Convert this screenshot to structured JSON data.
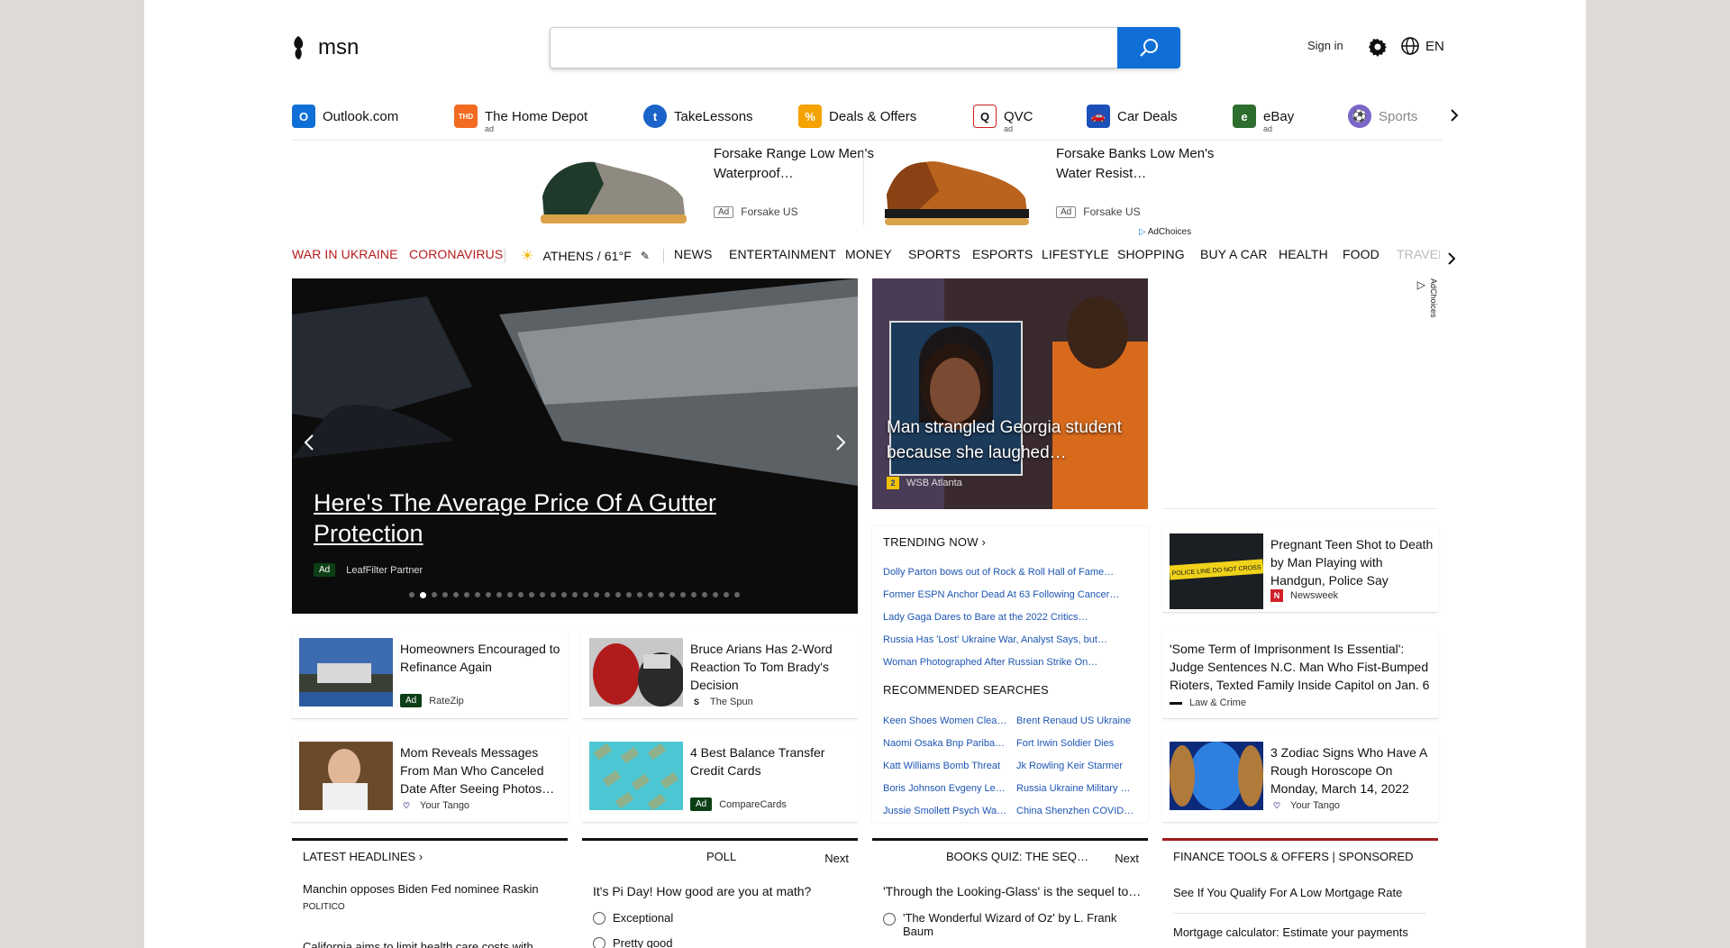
{
  "header": {
    "logo_text": "msn",
    "search_placeholder": "",
    "signin": "Sign in",
    "lang": "EN"
  },
  "quick_links": [
    {
      "label": "Outlook.com",
      "ad": "",
      "icon": "outlook-icon",
      "color": "#0f6fd6"
    },
    {
      "label": "The Home Depot",
      "ad": "ad",
      "icon": "home-depot-icon",
      "color": "#f26b21"
    },
    {
      "label": "TakeLessons",
      "ad": "",
      "icon": "takelessons-icon",
      "color": "#1b63c9"
    },
    {
      "label": "Deals & Offers",
      "ad": "",
      "icon": "deals-icon",
      "color": "#f5a300"
    },
    {
      "label": "QVC",
      "ad": "ad",
      "icon": "qvc-icon",
      "color": "#d02020"
    },
    {
      "label": "Car Deals",
      "ad": "",
      "icon": "car-icon",
      "color": "#1d4fb8"
    },
    {
      "label": "eBay",
      "ad": "ad",
      "icon": "ebay-icon",
      "color": "#2d6e2f"
    },
    {
      "label": "Sports",
      "ad": "",
      "icon": "sports-icon",
      "color": "#7a66c8"
    }
  ],
  "top_ads": [
    {
      "title": "Forsake Range Low Men's Waterproof…",
      "ad": "Ad",
      "source": "Forsake US"
    },
    {
      "title": "Forsake Banks Low Men's Water Resist…",
      "ad": "Ad",
      "source": "Forsake US"
    }
  ],
  "adchoices": "AdChoices",
  "nav": {
    "war": "WAR IN UKRAINE",
    "corona": "CORONAVIRUS",
    "weather": "ATHENS / 61°F",
    "items": [
      "NEWS",
      "ENTERTAINMENT",
      "MONEY",
      "SPORTS",
      "ESPORTS",
      "LIFESTYLE",
      "SHOPPING",
      "BUY A CAR",
      "HEALTH",
      "FOOD",
      "TRAVEL"
    ]
  },
  "hero": {
    "title": "Here's The Average Price Of A Gutter Protection",
    "ad": "Ad",
    "source": "LeafFilter Partner"
  },
  "mid_hero": {
    "title": "Man strangled Georgia student because she laughed…",
    "source": "WSB Atlanta"
  },
  "trending": {
    "title": "TRENDING NOW",
    "items": [
      "Dolly Parton bows out of Rock & Roll Hall of Fame…",
      "Former ESPN Anchor Dead At 63 Following Cancer…",
      "Lady Gaga Dares to Bare at the 2022 Critics…",
      "Russia Has 'Lost' Ukraine War, Analyst Says, but…",
      "Woman Photographed After Russian Strike On…"
    ],
    "rec_title": "RECOMMENDED SEARCHES",
    "rec_left": [
      "Keen Shoes Women Clea…",
      "Naomi Osaka Bnp Pariba…",
      "Katt Williams Bomb Threat",
      "Boris Johnson Evgeny Le…",
      "Jussie Smollett Psych Wa…"
    ],
    "rec_right": [
      "Brent Renaud US Ukraine",
      "Fort Irwin Soldier Dies",
      "Jk Rowling Keir Starmer",
      "Russia Ukraine Military …",
      "China Shenzhen COVID…"
    ]
  },
  "cards": {
    "refinance": {
      "title": "Homeowners Encouraged to Refinance Again",
      "ad": "Ad",
      "source": "RateZip"
    },
    "arians": {
      "title": "Bruce Arians Has 2-Word Reaction To Tom Brady's Decision",
      "source": "The Spun"
    },
    "mom": {
      "title": "Mom Reveals Messages From Man Who Canceled Date After Seeing Photos…",
      "source": "Your Tango"
    },
    "balance": {
      "title": "4 Best Balance Transfer Credit Cards",
      "ad": "Ad",
      "source": "CompareCards"
    },
    "teen": {
      "title": "Pregnant Teen Shot to Death by Man Playing with Handgun, Police Say",
      "source": "Newsweek",
      "tape": "POLICE LINE DO NOT CROSS"
    },
    "judge": {
      "title": "'Some Term of Imprisonment Is Essential': Judge Sentences N.C. Man Who Fist-Bumped Rioters, Texted Family Inside Capitol on Jan. 6",
      "source": "Law & Crime"
    },
    "zodiac": {
      "title": "3 Zodiac Signs Who Have A Rough Horoscope On Monday, March 14, 2022",
      "source": "Your Tango"
    }
  },
  "bottom": {
    "headlines": {
      "title": "LATEST HEADLINES",
      "items": [
        {
          "title": "Manchin opposes Biden Fed nominee Raskin",
          "source": "POLITICO"
        },
        {
          "title": "California aims to limit health care costs with",
          "source": ""
        }
      ]
    },
    "poll": {
      "title": "POLL",
      "next": "Next",
      "question": "It's Pi Day! How good are you at math?",
      "options": [
        "Exceptional",
        "Pretty good"
      ]
    },
    "quiz": {
      "title": "BOOKS QUIZ: THE SEQ…",
      "next": "Next",
      "question": "'Through the Looking-Glass' is the sequel to…",
      "options": [
        "'The Wonderful Wizard of Oz' by L. Frank Baum"
      ]
    },
    "finance": {
      "title": "FINANCE TOOLS & OFFERS | SPONSORED",
      "items": [
        "See If You Qualify For A Low Mortgage Rate",
        "Mortgage calculator: Estimate your payments"
      ]
    }
  }
}
